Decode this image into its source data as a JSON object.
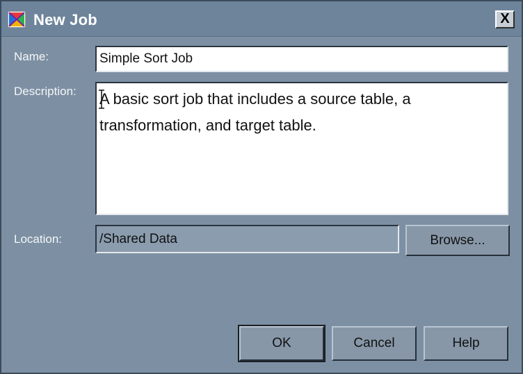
{
  "window": {
    "title": "New Job",
    "close_label": "X",
    "icon": "sas-job-icon"
  },
  "form": {
    "name_label": "Name:",
    "name_value": "Simple Sort Job",
    "description_label": "Description:",
    "description_value": "A basic sort job that includes a source table, a transformation, and target table.",
    "location_label": "Location:",
    "location_value": "/Shared Data",
    "browse_label": "Browse..."
  },
  "buttons": {
    "ok_label": "OK",
    "cancel_label": "Cancel",
    "help_label": "Help"
  },
  "colors": {
    "dialog_bg": "#7d90a3",
    "titlebar_bg": "#6d849b",
    "field_bg": "#ffffff",
    "readonly_field_bg": "#8a9cae"
  }
}
